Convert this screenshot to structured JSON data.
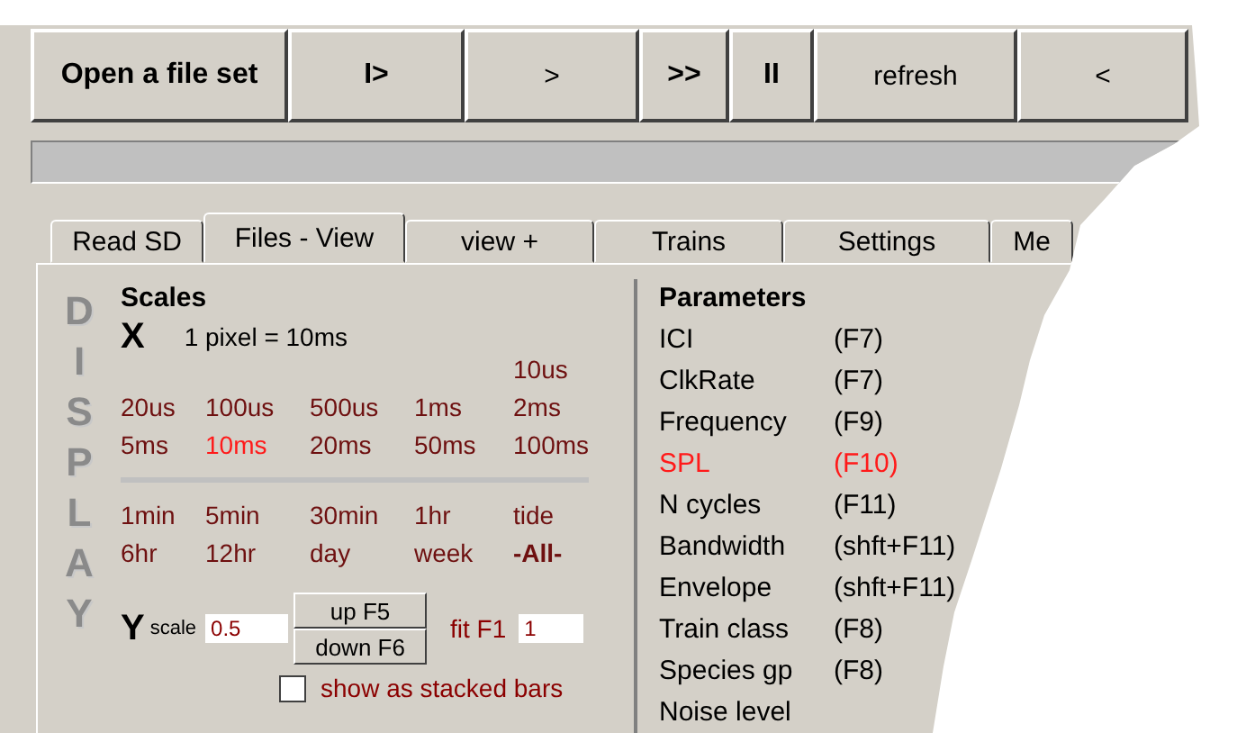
{
  "toolbar": [
    {
      "label": "Open a file set",
      "bold": true
    },
    {
      "label": "I>",
      "bold": true
    },
    {
      "label": ">",
      "bold": false
    },
    {
      "label": ">>",
      "bold": true
    },
    {
      "label": "II",
      "bold": true
    },
    {
      "label": "refresh",
      "bold": false
    },
    {
      "label": "<",
      "bold": false
    }
  ],
  "progress": {
    "level": 0
  },
  "tabs": [
    {
      "label": "Read SD",
      "selected": false
    },
    {
      "label": "Files - View",
      "selected": true
    },
    {
      "label": "view +",
      "selected": false
    },
    {
      "label": "Trains",
      "selected": false
    },
    {
      "label": "Settings",
      "selected": false
    },
    {
      "label": "Me",
      "selected": false
    }
  ],
  "side_title": [
    "D",
    "I",
    "S",
    "P",
    "L",
    "A",
    "Y"
  ],
  "scales": {
    "title": "Scales",
    "x_label": "X",
    "x_reading": "1 pixel = 10ms",
    "extra": {
      "label": "10us",
      "selected": false,
      "emphasis": false
    },
    "fine_rows": [
      [
        {
          "label": "20us",
          "selected": false,
          "emphasis": false
        },
        {
          "label": "100us",
          "selected": false,
          "emphasis": false
        },
        {
          "label": "500us",
          "selected": false,
          "emphasis": false
        },
        {
          "label": "1ms",
          "selected": false,
          "emphasis": false
        },
        {
          "label": "2ms",
          "selected": false,
          "emphasis": false
        }
      ],
      [
        {
          "label": "5ms",
          "selected": false,
          "emphasis": false
        },
        {
          "label": "10ms",
          "selected": true,
          "emphasis": false
        },
        {
          "label": "20ms",
          "selected": false,
          "emphasis": false
        },
        {
          "label": "50ms",
          "selected": false,
          "emphasis": false
        },
        {
          "label": "100ms",
          "selected": false,
          "emphasis": false
        }
      ]
    ],
    "coarse_rows": [
      [
        {
          "label": "1min",
          "selected": false,
          "emphasis": false
        },
        {
          "label": "5min",
          "selected": false,
          "emphasis": false
        },
        {
          "label": "30min",
          "selected": false,
          "emphasis": false
        },
        {
          "label": "1hr",
          "selected": false,
          "emphasis": false
        },
        {
          "label": "tide",
          "selected": false,
          "emphasis": false
        }
      ],
      [
        {
          "label": "6hr",
          "selected": false,
          "emphasis": false
        },
        {
          "label": "12hr",
          "selected": false,
          "emphasis": false
        },
        {
          "label": "day",
          "selected": false,
          "emphasis": false
        },
        {
          "label": "week",
          "selected": false,
          "emphasis": false
        },
        {
          "label": "-All-",
          "selected": false,
          "emphasis": true
        }
      ]
    ],
    "y_label": "Y",
    "y_scale_label": "scale",
    "y_value": "0.5",
    "up_button": "up F5",
    "down_button": "down F6",
    "fit_label": "fit F1",
    "fit_value": "1",
    "stacked": {
      "label": "show as stacked bars",
      "checked": false
    }
  },
  "parameters": {
    "title": "Parameters",
    "items": [
      {
        "name": "ICI",
        "key": "(F7)",
        "selected": false
      },
      {
        "name": "ClkRate",
        "key": "(F7)",
        "selected": false
      },
      {
        "name": "Frequency",
        "key": "(F9)",
        "selected": false
      },
      {
        "name": "SPL",
        "key": "(F10)",
        "selected": true
      },
      {
        "name": "N cycles",
        "key": "(F11)",
        "selected": false
      },
      {
        "name": "Bandwidth",
        "key": "(shft+F11)",
        "selected": false
      },
      {
        "name": "Envelope",
        "key": "(shft+F11)",
        "selected": false
      },
      {
        "name": "Train class",
        "key": "(F8)",
        "selected": false
      },
      {
        "name": "Species gp",
        "key": "(F8)",
        "selected": false
      },
      {
        "name": "Noise level",
        "selected": false
      }
    ]
  }
}
